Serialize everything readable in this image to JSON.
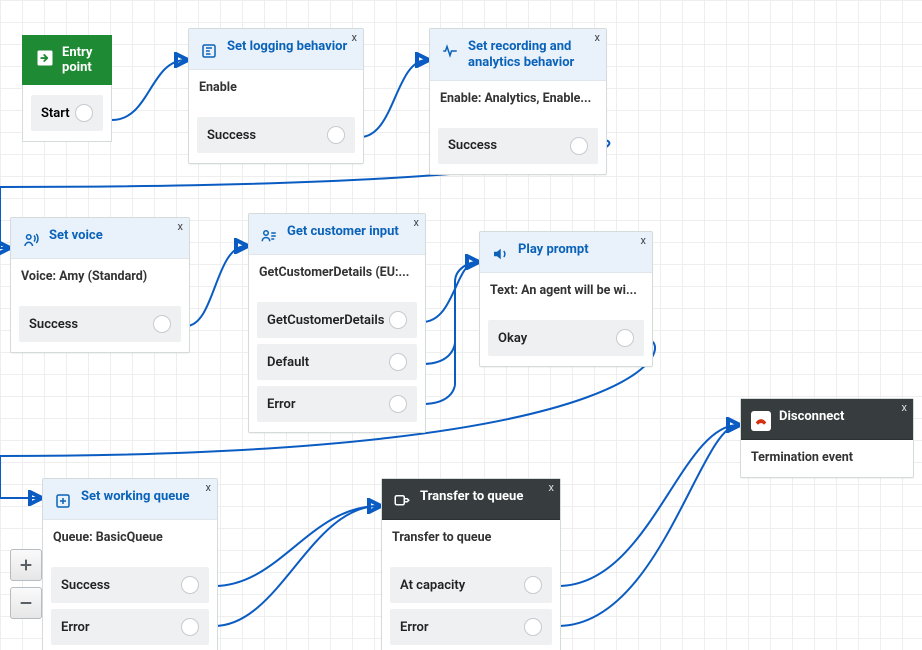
{
  "entry": {
    "title": "Entry point",
    "out": "Start"
  },
  "logging": {
    "title": "Set logging behavior",
    "summary": "Enable",
    "out": "Success"
  },
  "recording": {
    "title": "Set recording and analytics behavior",
    "summary": "Enable: Analytics, Enable...",
    "out": "Success"
  },
  "voice": {
    "title": "Set voice",
    "summary": "Voice: Amy (Standard)",
    "out": "Success"
  },
  "customer": {
    "title": "Get customer input",
    "summary": "GetCustomerDetails (EU:...",
    "outs": [
      "GetCustomerDetails",
      "Default",
      "Error"
    ]
  },
  "prompt": {
    "title": "Play prompt",
    "summary": "Text: An agent will be wi...",
    "out": "Okay"
  },
  "queue": {
    "title": "Set working queue",
    "summary": "Queue: BasicQueue",
    "outs": [
      "Success",
      "Error"
    ]
  },
  "transfer": {
    "title": "Transfer to queue",
    "summary": "Transfer to queue",
    "outs": [
      "At capacity",
      "Error"
    ]
  },
  "disconnect": {
    "title": "Disconnect",
    "summary": "Termination event"
  },
  "close_x": "x",
  "chart_data": {
    "type": "flow",
    "nodes": [
      {
        "id": "entry",
        "label": "Entry point",
        "kind": "start",
        "outputs": [
          "Start"
        ]
      },
      {
        "id": "logging",
        "label": "Set logging behavior",
        "summary": "Enable",
        "outputs": [
          "Success"
        ]
      },
      {
        "id": "recording",
        "label": "Set recording and analytics behavior",
        "summary": "Enable: Analytics, Enable...",
        "outputs": [
          "Success"
        ]
      },
      {
        "id": "voice",
        "label": "Set voice",
        "summary": "Voice: Amy (Standard)",
        "outputs": [
          "Success"
        ]
      },
      {
        "id": "customer",
        "label": "Get customer input",
        "summary": "GetCustomerDetails (EU:...",
        "outputs": [
          "GetCustomerDetails",
          "Default",
          "Error"
        ]
      },
      {
        "id": "prompt",
        "label": "Play prompt",
        "summary": "Text: An agent will be wi...",
        "outputs": [
          "Okay"
        ]
      },
      {
        "id": "queue",
        "label": "Set working queue",
        "summary": "Queue: BasicQueue",
        "outputs": [
          "Success",
          "Error"
        ]
      },
      {
        "id": "transfer",
        "label": "Transfer to queue",
        "summary": "Transfer to queue",
        "outputs": [
          "At capacity",
          "Error"
        ]
      },
      {
        "id": "disconnect",
        "label": "Disconnect",
        "summary": "Termination event",
        "kind": "end"
      }
    ],
    "edges": [
      {
        "from": "entry",
        "out": "Start",
        "to": "logging"
      },
      {
        "from": "logging",
        "out": "Success",
        "to": "recording"
      },
      {
        "from": "recording",
        "out": "Success",
        "to": "voice"
      },
      {
        "from": "voice",
        "out": "Success",
        "to": "customer"
      },
      {
        "from": "customer",
        "out": "GetCustomerDetails",
        "to": "prompt"
      },
      {
        "from": "customer",
        "out": "Default",
        "to": "prompt"
      },
      {
        "from": "customer",
        "out": "Error",
        "to": "prompt"
      },
      {
        "from": "prompt",
        "out": "Okay",
        "to": "queue"
      },
      {
        "from": "queue",
        "out": "Success",
        "to": "transfer"
      },
      {
        "from": "queue",
        "out": "Error",
        "to": "transfer"
      },
      {
        "from": "transfer",
        "out": "At capacity",
        "to": "disconnect"
      },
      {
        "from": "transfer",
        "out": "Error",
        "to": "disconnect"
      }
    ]
  }
}
